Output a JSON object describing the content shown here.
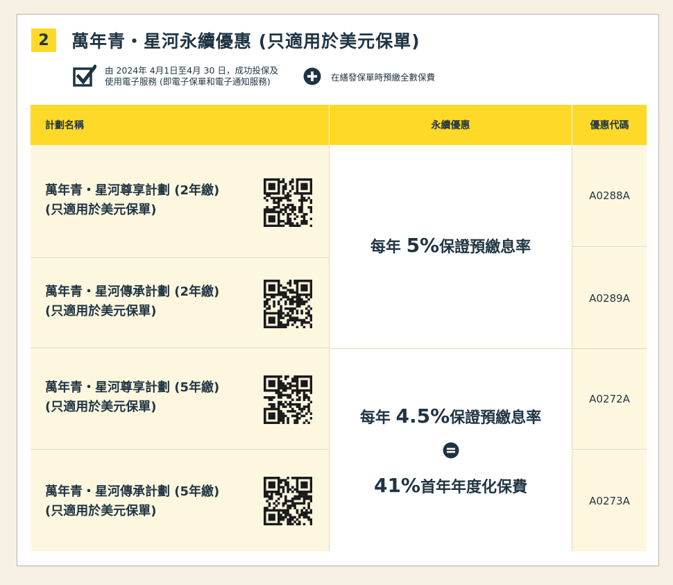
{
  "section": {
    "number": "2",
    "title": "萬年青・星河永續優惠 (只適用於美元保單)"
  },
  "conditions": {
    "line1": "由 2024年 4月1日至4月 30 日，成功投保及",
    "line2": "使用電子服務 (即電子保單和電子通知服務)",
    "extra": "在繕發保單時預繳全數保費",
    "check_icon": "checkbox-icon",
    "plus_icon": "plus-circle-icon"
  },
  "table": {
    "headers": [
      "計劃名稱",
      "永續優惠",
      "優惠代碼"
    ],
    "plans": [
      {
        "line1": "萬年青・星河尊享計劃 (2年繳)",
        "line2": "(只適用於美元保單)",
        "code": "A0288A"
      },
      {
        "line1": "萬年青・星河傳承計劃 (2年繳)",
        "line2": "(只適用於美元保單)",
        "code": "A0289A"
      },
      {
        "line1": "萬年青・星河尊享計劃 (5年繳)",
        "line2": "(只適用於美元保單)",
        "code": "A0272A"
      },
      {
        "line1": "萬年青・星河傳承計劃 (5年繳)",
        "line2": "(只適用於美元保單)",
        "code": "A0273A"
      }
    ],
    "offers": [
      {
        "prefix": "每年",
        "rate": "5%",
        "suffix": "保證預繳息率"
      },
      {
        "prefix": "每年",
        "rate": "4.5%",
        "suffix": "保證預繳息率",
        "equals_icon": "equals-circle-icon",
        "rate2": "41%",
        "suffix2": "首年年度化保費"
      }
    ]
  },
  "colors": {
    "accent": "#ffd928",
    "text": "#1f3442",
    "row_bg": "#fdf7e0",
    "page_bg": "#f5efe4"
  }
}
